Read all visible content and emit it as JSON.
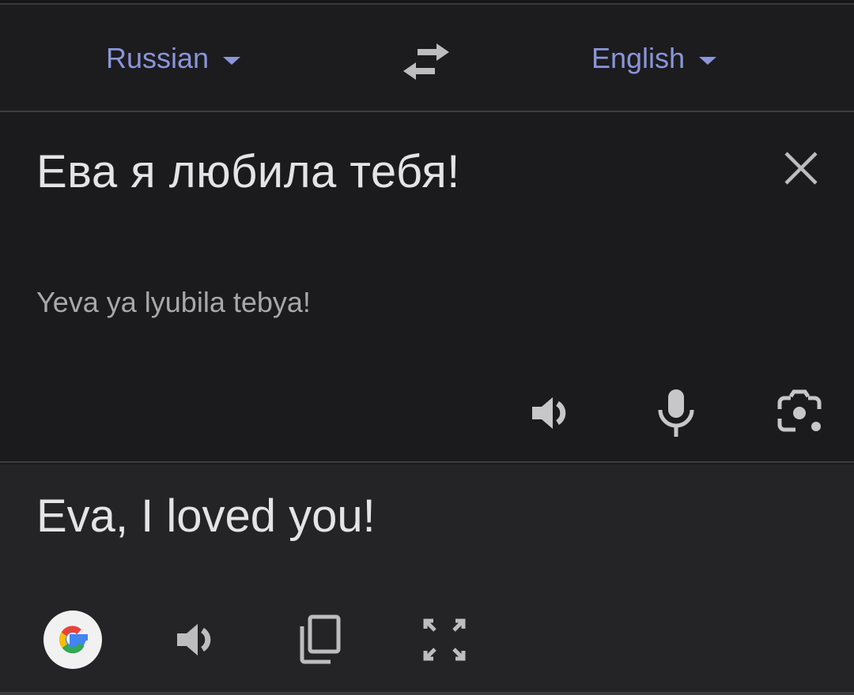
{
  "languages": {
    "source": "Russian",
    "target": "English"
  },
  "input": {
    "text": "Ева я любила тебя!",
    "transliteration": "Yeva ya lyubila tebya!"
  },
  "output": {
    "text": "Eva, I loved you!"
  },
  "icons": {
    "swap": "swap-languages-icon",
    "clear": "close-icon",
    "source_tools": [
      "speaker-icon",
      "microphone-icon",
      "camera-icon"
    ],
    "output_tools": [
      "google-logo-icon",
      "speaker-icon",
      "copy-icon",
      "fullscreen-icon"
    ]
  },
  "colors": {
    "accent": "#8b95d8",
    "text": "#e4e4e6",
    "background": "#1b1b1d",
    "output_background": "#242426"
  }
}
